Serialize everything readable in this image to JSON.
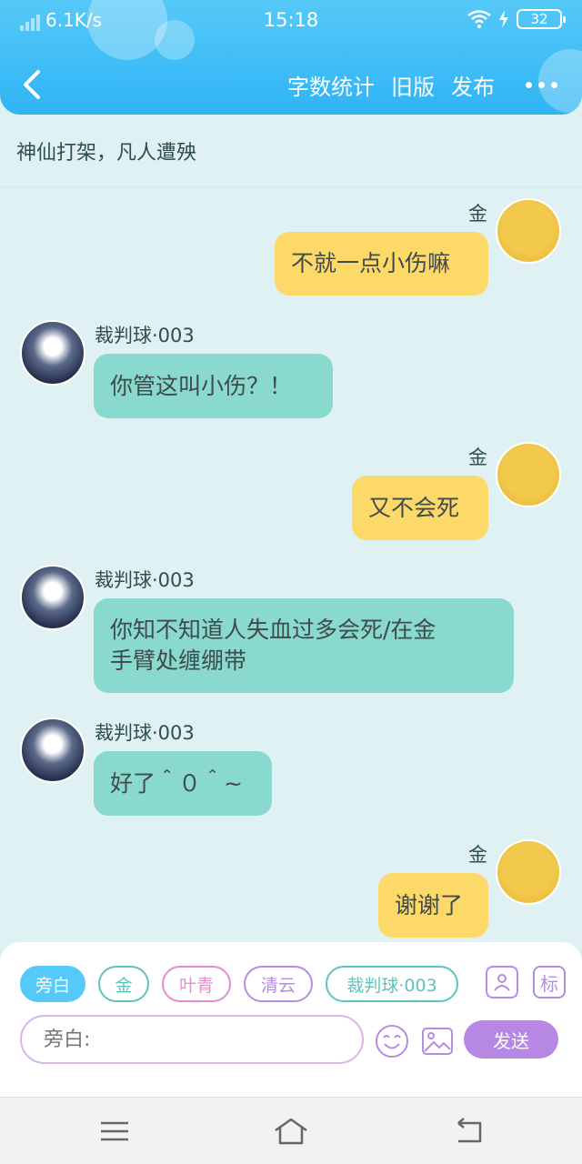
{
  "status_bar": {
    "network_speed": "6.1K/s",
    "time": "15:18",
    "battery": "32"
  },
  "header": {
    "actions": [
      "字数统计",
      "旧版",
      "发布"
    ]
  },
  "scene_title": "神仙打架，凡人遭殃",
  "messages": [
    {
      "side": "right",
      "name": "金",
      "text": "不就一点小伤嘛"
    },
    {
      "side": "left",
      "name": "裁判球·003",
      "text": "你管这叫小伤？！"
    },
    {
      "side": "right",
      "name": "金",
      "text": "又不会死"
    },
    {
      "side": "left",
      "name": "裁判球·003",
      "text_line1": "你知不知道人失血过多会死/在金",
      "text_line2": "手臂处缠绷带"
    },
    {
      "side": "left",
      "name": "裁判球·003",
      "text": "好了＾０＾~"
    },
    {
      "side": "right",
      "name": "金",
      "text": "谢谢了"
    }
  ],
  "composer": {
    "roles": [
      "旁白",
      "金",
      "叶青",
      "清云",
      "裁判球·003"
    ],
    "role_colors": [
      "#55c9f7",
      "#5fc4bb",
      "#e78ad0",
      "#b58de0",
      "#5fc4bb"
    ],
    "tool_mark_label": "标",
    "input_placeholder": "旁白:",
    "send_label": "发送"
  },
  "colors": {
    "header": "#2fb4f5",
    "bubble_right": "#fdd96a",
    "bubble_left": "#8ad9cf",
    "send": "#b787e4"
  }
}
